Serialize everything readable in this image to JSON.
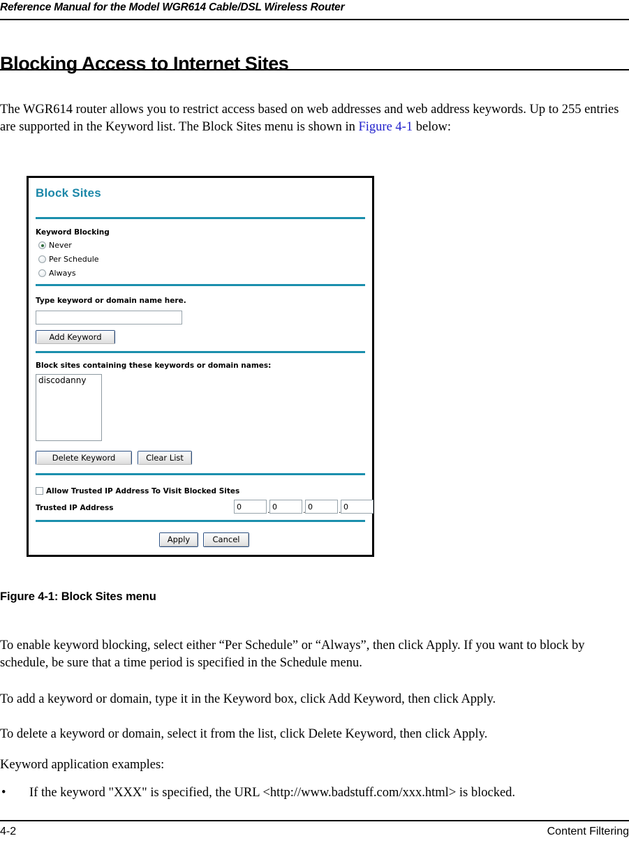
{
  "document": {
    "running_header": "Reference Manual for the Model WGR614 Cable/DSL Wireless Router",
    "chapter_title": "Blocking Access to Internet Sites",
    "intro_part1": "The WGR614 router allows you to restrict access based on web addresses and web address keywords. Up to 255 entries are supported in the Keyword list. The Block Sites menu is shown in ",
    "intro_xref": "Figure 4-1",
    "intro_part2": " below:",
    "figure_caption": "Figure 4-1: Block Sites menu",
    "paragraph_enable": "To enable keyword blocking, select either “Per Schedule” or “Always”, then click Apply. If you want to block by schedule, be sure that a time period is specified in the Schedule menu.",
    "paragraph_add": "To add a keyword or domain, type it in the Keyword box, click Add Keyword, then click Apply.",
    "paragraph_delete": "To delete a keyword or domain, select it from the list, click Delete Keyword, then click Apply.",
    "paragraph_examples_heading": "Keyword application examples:",
    "bullet_mark": "•",
    "bullet_text": "If the keyword \"XXX\" is specified, the URL <http://www.badstuff.com/xxx.html> is blocked.",
    "footer_page": "4-2",
    "footer_section": "Content Filtering"
  },
  "colors": {
    "accent_teal": "#1b8fad",
    "title_teal": "#1b87a8",
    "xref_blue": "#2222cc",
    "radio_dot": "#2d6b3a",
    "button_border": "#2b4f81"
  },
  "block_sites_screen": {
    "title": "Block Sites",
    "keyword_blocking": {
      "label": "Keyword Blocking",
      "options": [
        {
          "label": "Never",
          "selected": true
        },
        {
          "label": "Per Schedule",
          "selected": false
        },
        {
          "label": "Always",
          "selected": false
        }
      ]
    },
    "keyword_entry": {
      "label": "Type keyword or domain name here.",
      "value": "",
      "placeholder": "",
      "add_button": "Add Keyword"
    },
    "keyword_list": {
      "label": "Block sites containing these keywords or domain names:",
      "items": [
        "discodanny"
      ],
      "delete_button": "Delete Keyword",
      "clear_button": "Clear List"
    },
    "trusted_ip": {
      "checkbox_label": "Allow Trusted IP Address To Visit Blocked Sites",
      "checked": false,
      "address_label": "Trusted IP Address",
      "octets": [
        "0",
        "0",
        "0",
        "0"
      ],
      "separator": "."
    },
    "actions": {
      "apply": "Apply",
      "cancel": "Cancel"
    }
  }
}
